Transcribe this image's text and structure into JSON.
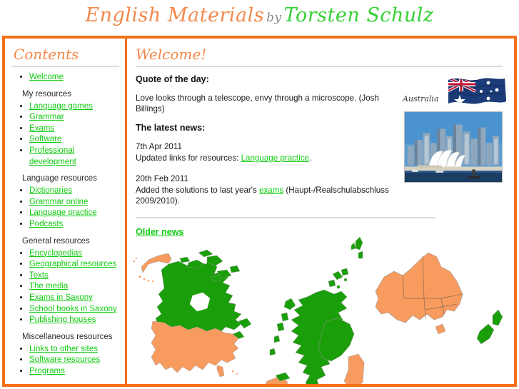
{
  "colors": {
    "frame_orange": "#f4701b",
    "heading_orange": "#f4884a",
    "link_green": "#11cc11",
    "author_green": "#35d135",
    "map_green": "#1a9e0a",
    "map_orange": "#f79b5e",
    "rule_gray": "#dcdcdc"
  },
  "header": {
    "brand_main": "English Materials",
    "brand_by": "by",
    "brand_author": "Torsten Schulz"
  },
  "sidebar": {
    "title": "Contents",
    "groups": [
      {
        "label": "",
        "items": [
          {
            "label": "Welcome"
          }
        ]
      },
      {
        "label": "My resources",
        "items": [
          {
            "label": "Language games"
          },
          {
            "label": "Grammar"
          },
          {
            "label": "Exams"
          },
          {
            "label": "Software"
          },
          {
            "label": "Professional development"
          }
        ]
      },
      {
        "label": "Language resources",
        "items": [
          {
            "label": "Dictionaries"
          },
          {
            "label": "Grammar online"
          },
          {
            "label": "Language practice"
          },
          {
            "label": "Podcasts"
          }
        ]
      },
      {
        "label": "General resources",
        "items": [
          {
            "label": "Encyclopedias"
          },
          {
            "label": "Geographical resources"
          },
          {
            "label": "Texts"
          },
          {
            "label": "The media"
          },
          {
            "label": "Exams in Saxony"
          },
          {
            "label": "School books in Saxony"
          },
          {
            "label": "Publishing houses"
          }
        ]
      },
      {
        "label": "Miscellaneous resources",
        "items": [
          {
            "label": "Links to other sites"
          },
          {
            "label": "Software resources"
          },
          {
            "label": "Programs"
          }
        ]
      }
    ]
  },
  "main": {
    "title": "Welcome!",
    "quote_heading": "Quote of the day:",
    "quote_text": "Love looks through a telescope, envy through a microscope. (Josh Billings)",
    "news_heading": "The latest news:",
    "news": [
      {
        "date": "7th Apr 2011",
        "text_before": "Updated links for resources: ",
        "link": "Language practice",
        "text_after": "."
      },
      {
        "date": "20th Feb 2011",
        "text_before": "Added the solutions to last year's ",
        "link": "exams",
        "text_after": " (Haupt-/Realschulabschluss 2009/2010)."
      }
    ],
    "older_news_label": "Older news"
  },
  "australia": {
    "caption": "Australia",
    "flag_name": "australian-flag",
    "photo_name": "sydney-harbour-photo"
  },
  "map": {
    "name": "english-speaking-countries-map",
    "regions": [
      {
        "name": "alaska",
        "color": "#f79b5e"
      },
      {
        "name": "canada",
        "color": "#1a9e0a"
      },
      {
        "name": "united-states",
        "color": "#f79b5e"
      },
      {
        "name": "united-kingdom",
        "color": "#1a9e0a"
      },
      {
        "name": "ireland",
        "color": "#f79b5e"
      },
      {
        "name": "australia",
        "color": "#f79b5e"
      },
      {
        "name": "new-zealand",
        "color": "#1a9e0a"
      }
    ]
  }
}
